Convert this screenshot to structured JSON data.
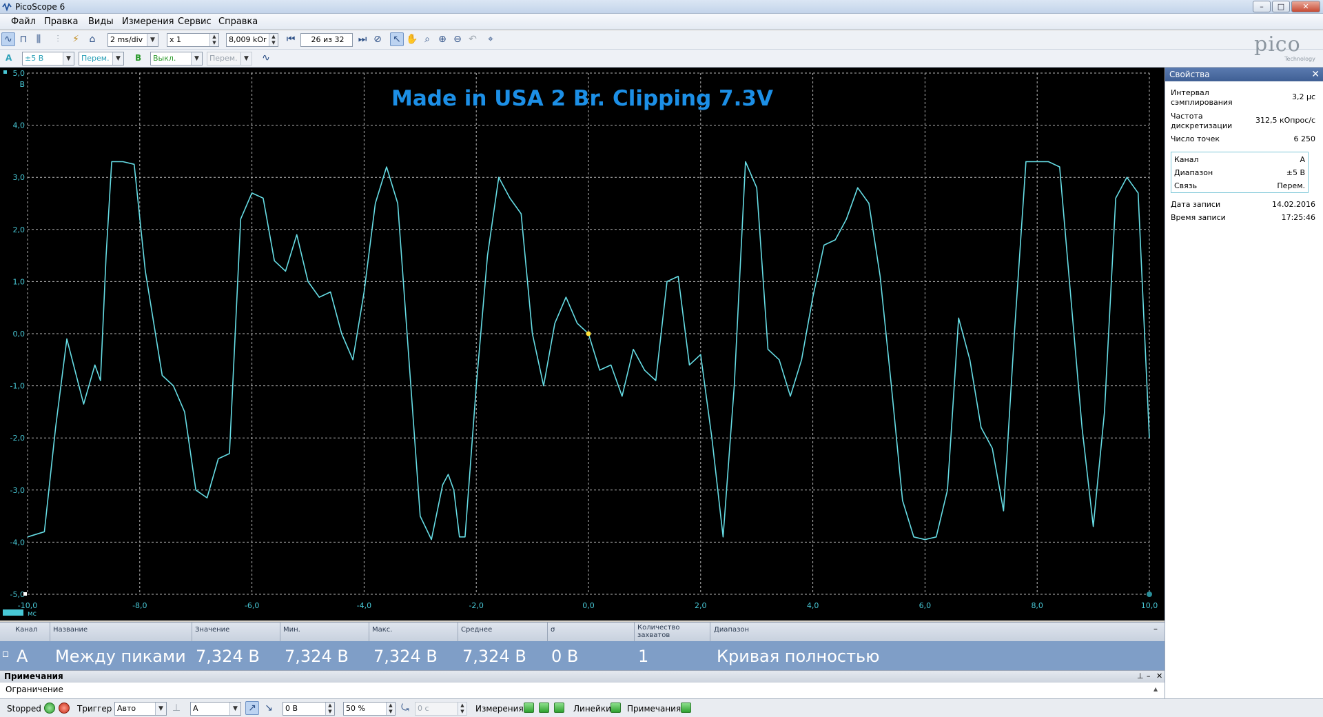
{
  "window": {
    "title": "PicoScope 6",
    "controls": [
      "–",
      "□",
      "✕"
    ]
  },
  "menu": [
    "Файл",
    "Правка",
    "Виды",
    "Измерения",
    "Сервис",
    "Справка"
  ],
  "toolbar": {
    "timebase": "2 ms/div",
    "zoom": "x 1",
    "frequency": "8,009 kOr",
    "buffer": "26 из 32"
  },
  "channels": {
    "a": {
      "name": "A",
      "range": "±5 В",
      "coupling": "Перем."
    },
    "b": {
      "name": "B",
      "range": "Выкл.",
      "coupling": "Перем."
    }
  },
  "logo": {
    "word": "pico",
    "sub": "Technology"
  },
  "scope": {
    "title": "Made in USA 2 Br. Clipping 7.3V",
    "xUnit": "мс",
    "y_ticks": [
      "5,0",
      "4,0",
      "3,0",
      "2,0",
      "1,0",
      "0,0",
      "-1,0",
      "-2,0",
      "-3,0",
      "-4,0",
      "-5,0"
    ],
    "y_axis_top_label": "В",
    "x_ticks": [
      "-10,0",
      "-8,0",
      "-6,0",
      "-4,0",
      "-2,0",
      "0,0",
      "2,0",
      "4,0",
      "6,0",
      "8,0",
      "10,0"
    ]
  },
  "chart_data": {
    "type": "line",
    "title": "Made in USA 2 Br. Clipping 7.3V",
    "xlabel": "мс",
    "ylabel": "В",
    "xlim": [
      -10,
      10
    ],
    "ylim": [
      -5,
      5
    ],
    "grid": true,
    "series": [
      {
        "color": "#66dde5",
        "x": [
          -10.0,
          -9.7,
          -9.5,
          -9.3,
          -9.0,
          -8.8,
          -8.7,
          -8.6,
          -8.5,
          -8.3,
          -8.1,
          -7.9,
          -7.6,
          -7.4,
          -7.2,
          -7.0,
          -6.8,
          -6.6,
          -6.4,
          -6.2,
          -6.0,
          -5.8,
          -5.6,
          -5.4,
          -5.2,
          -5.0,
          -4.8,
          -4.6,
          -4.4,
          -4.2,
          -4.0,
          -3.8,
          -3.6,
          -3.4,
          -3.2,
          -3.0,
          -2.8,
          -2.6,
          -2.5,
          -2.4,
          -2.3,
          -2.2,
          -2.0,
          -1.8,
          -1.6,
          -1.4,
          -1.2,
          -1.0,
          -0.8,
          -0.6,
          -0.4,
          -0.2,
          0.0,
          0.2,
          0.4,
          0.6,
          0.8,
          1.0,
          1.2,
          1.4,
          1.6,
          1.8,
          2.0,
          2.2,
          2.4,
          2.6,
          2.8,
          3.0,
          3.2,
          3.4,
          3.6,
          3.8,
          4.0,
          4.2,
          4.4,
          4.6,
          4.8,
          5.0,
          5.2,
          5.4,
          5.6,
          5.8,
          6.0,
          6.2,
          6.4,
          6.6,
          6.8,
          7.0,
          7.2,
          7.4,
          7.6,
          7.8,
          8.0,
          8.2,
          8.4,
          8.6,
          8.8,
          9.0,
          9.2,
          9.4,
          9.6,
          9.8,
          10.0
        ],
        "y": [
          -3.9,
          -3.8,
          -1.8,
          -0.1,
          -1.35,
          -0.6,
          -0.9,
          1.5,
          3.3,
          3.3,
          3.25,
          1.2,
          -0.8,
          -1.0,
          -1.5,
          -3.0,
          -3.15,
          -2.4,
          -2.3,
          2.2,
          2.7,
          2.6,
          1.4,
          1.2,
          1.9,
          1.0,
          0.7,
          0.8,
          0.0,
          -0.5,
          0.8,
          2.5,
          3.2,
          2.5,
          -0.5,
          -3.5,
          -3.95,
          -2.9,
          -2.7,
          -3.0,
          -3.9,
          -3.9,
          -1.0,
          1.5,
          3.0,
          2.6,
          2.3,
          0.0,
          -1.0,
          0.2,
          0.7,
          0.2,
          0.0,
          -0.7,
          -0.6,
          -1.2,
          -0.3,
          -0.7,
          -0.9,
          1.0,
          1.1,
          -0.6,
          -0.4,
          -2.0,
          -3.9,
          -1.0,
          3.3,
          2.8,
          -0.3,
          -0.5,
          -1.2,
          -0.5,
          0.7,
          1.7,
          1.8,
          2.2,
          2.8,
          2.5,
          1.1,
          -1.0,
          -3.2,
          -3.9,
          -3.95,
          -3.9,
          -3.0,
          0.3,
          -0.5,
          -1.8,
          -2.2,
          -3.4,
          0.1,
          3.3,
          3.3,
          3.3,
          3.2,
          0.7,
          -1.8,
          -3.7,
          -1.5,
          2.6,
          3.0,
          2.7,
          -2.0
        ]
      }
    ],
    "annotations": [
      "Made in USA 2 Br. Clipping 7.3V"
    ]
  },
  "properties": {
    "header": "Свойства",
    "rows": [
      {
        "label": "Интервал\nсэмплирования",
        "value": "3,2 µс"
      },
      {
        "label": "Частота\nдискретизации",
        "value": "312,5 кОпрос/с"
      },
      {
        "label": "Число точек",
        "value": "6 250"
      }
    ],
    "channel_box": [
      {
        "label": "Канал",
        "value": "A"
      },
      {
        "label": "Диапазон",
        "value": "±5 В"
      },
      {
        "label": "Связь",
        "value": "Перем."
      }
    ],
    "rows2": [
      {
        "label": "Дата записи",
        "value": "14.02.2016"
      },
      {
        "label": "Время записи",
        "value": "17:25:46"
      }
    ]
  },
  "measurements": {
    "headers": [
      "Канал",
      "Название",
      "Значение",
      "Мин.",
      "Макс.",
      "Среднее",
      "σ",
      "Количество\nзахватов",
      "Диапазон"
    ],
    "row": [
      "A",
      "Между пиками",
      "7,324 В",
      "7,324 В",
      "7,324 В",
      "7,324 В",
      "0 В",
      "1",
      "Кривая полностью"
    ]
  },
  "notes": {
    "title": "Примечания",
    "text": "Ограничение"
  },
  "status": {
    "state": "Stopped",
    "trigger_label": "Триггер",
    "trigger_mode": "Авто",
    "trigger_channel": "A",
    "trigger_level": "0 В",
    "pretrigger": "50 %",
    "delay": "0 с",
    "measure_label": "Измерения",
    "rulers_label": "Линейки",
    "notes_label": "Примечания"
  }
}
